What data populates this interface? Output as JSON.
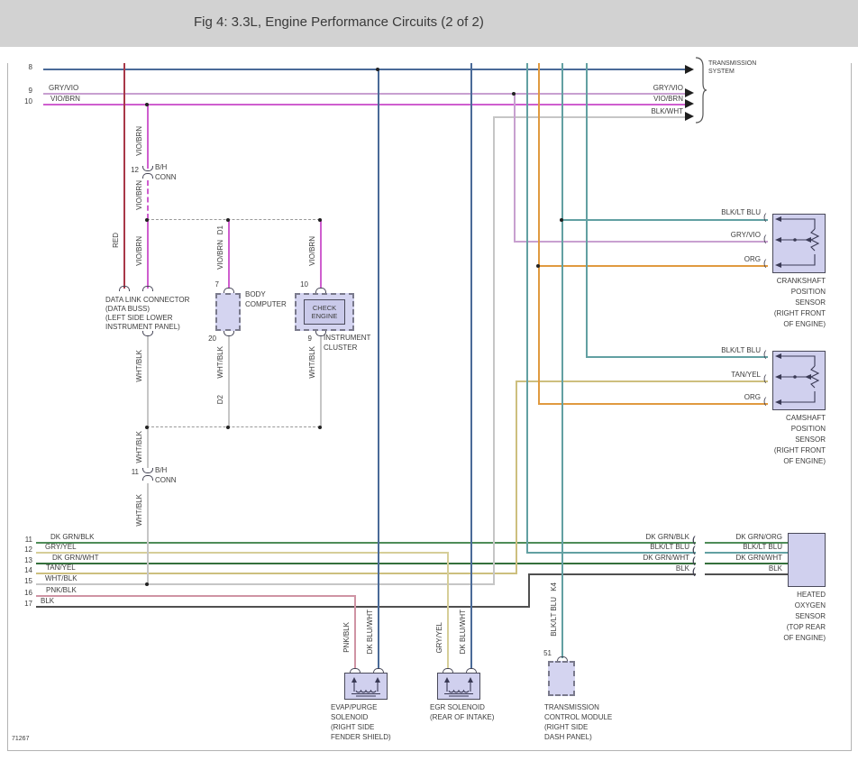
{
  "header": {
    "title": "Fig 4: 3.3L, Engine Performance Circuits (2 of 2)"
  },
  "code": "71267",
  "rows": {
    "n8": "8",
    "n9": "9",
    "n10": "10",
    "n11": "11",
    "n12": "12",
    "n13": "13",
    "n14": "14",
    "n15": "15",
    "n16": "16",
    "n17": "17",
    "l9": "GRY/VIO",
    "l10": "VIO/BRN",
    "l11": "DK GRN/BLK",
    "l12": "GRY/YEL",
    "l13": "DK GRN/WHT",
    "l14": "TAN/YEL",
    "l15": "WHT/BLK",
    "l16": "PNK/BLK",
    "l17": "BLK"
  },
  "wire": {
    "red": "RED",
    "vio_brn": "VIO/BRN",
    "wht_blk": "WHT/BLK",
    "d1": "D1",
    "d2": "D2",
    "k4": "K4",
    "dk_blu_wht": "DK BLU/WHT",
    "pnk_blk": "PNK/BLK",
    "gry_yel": "GRY/YEL",
    "blk_lt_blu": "BLK/LT BLU"
  },
  "conn": {
    "bh": "B/H\nCONN",
    "p12": "12",
    "p11": "11",
    "p7": "7",
    "p20": "20",
    "p10": "10",
    "p9": "9",
    "p51": "51"
  },
  "glyphs": {
    "inline_conn": "((",
    "pin_conn": "("
  },
  "transmission": {
    "line1": "TRANSMISSION",
    "line2": "SYSTEM",
    "a1": "GRY/VIO",
    "a2": "VIO/BRN",
    "a3": "BLK/WHT"
  },
  "dlc": {
    "l1": "DATA LINK CONNECTOR",
    "l2": "(DATA BUSS)",
    "l3": "(LEFT SIDE LOWER",
    "l4": "INSTRUMENT PANEL)"
  },
  "body_computer": {
    "l1": "BODY",
    "l2": "COMPUTER"
  },
  "check_engine": {
    "l1": "CHECK",
    "l2": "ENGINE"
  },
  "instrument_cluster": {
    "l1": "INSTRUMENT",
    "l2": "CLUSTER"
  },
  "crank": {
    "p1": "BLK/LT BLU",
    "p2": "GRY/VIO",
    "p3": "ORG",
    "n1": "CRANKSHAFT",
    "n2": "POSITION",
    "n3": "SENSOR",
    "n4": "(RIGHT FRONT",
    "n5": "OF ENGINE)"
  },
  "cam": {
    "p1": "BLK/LT BLU",
    "p2": "TAN/YEL",
    "p3": "ORG",
    "n1": "CAMSHAFT",
    "n2": "POSITION",
    "n3": "SENSOR",
    "n4": "(RIGHT FRONT",
    "n5": "OF ENGINE)"
  },
  "o2": {
    "lft1": "DK GRN/BLK",
    "lft2": "BLK/LT BLU",
    "lft3": "DK GRN/WHT",
    "lft4": "BLK",
    "rgt1": "DK GRN/ORG",
    "rgt2": "BLK/LT BLU",
    "rgt3": "DK GRN/WHT",
    "rgt4": "BLK",
    "n1": "HEATED",
    "n2": "OXYGEN",
    "n3": "SENSOR",
    "n4": "(TOP REAR",
    "n5": "OF ENGINE)"
  },
  "evap": {
    "n1": "EVAP/PURGE",
    "n2": "SOLENOID",
    "n3": "(RIGHT SIDE",
    "n4": "FENDER SHIELD)"
  },
  "egr": {
    "n1": "EGR SOLENOID",
    "n2": "(REAR OF INTAKE)"
  },
  "tcm": {
    "n1": "TRANSMISSION",
    "n2": "CONTROL MODULE",
    "n3": "(RIGHT SIDE",
    "n4": "DASH PANEL)"
  },
  "colors": {
    "header_bg": "#d2d2d2",
    "box_fill": "#d4d4f0",
    "dk_blu_wht": "#4a6a98",
    "blk_lt_blu": "#62a0a2",
    "org": "#e09a40",
    "gry_vio": "#c8a0d0",
    "vio_brn": "#cf5ecf",
    "red": "#a83848",
    "wht_blk": "#c6c6c6",
    "dk_grn_blk": "#4e8c58",
    "dk_grn_wht": "#35703c",
    "gry_yel": "#d6ce98",
    "tan_yel": "#cdbf7e",
    "pnk_blk": "#cf94a4",
    "blk": "#505050"
  }
}
